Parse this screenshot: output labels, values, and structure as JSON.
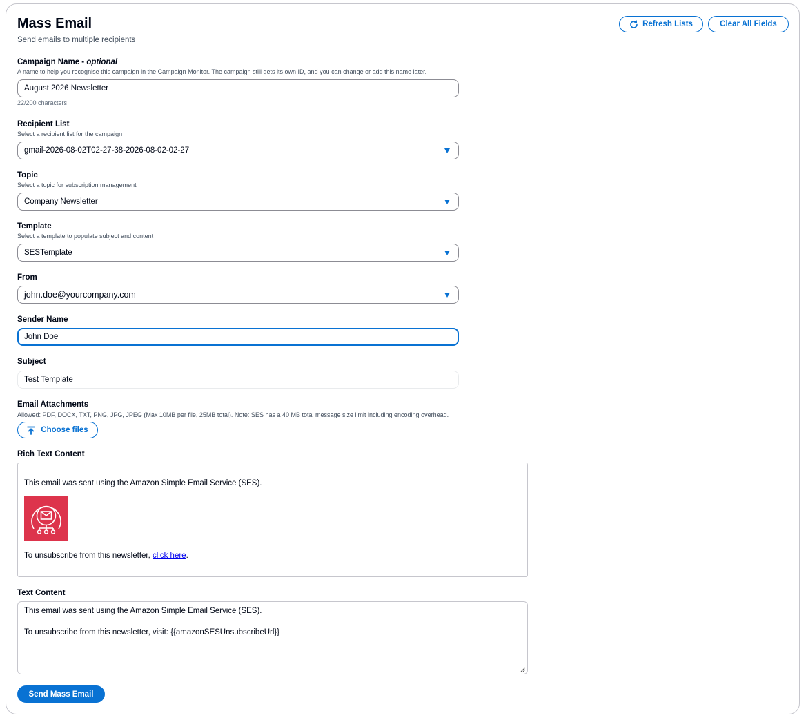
{
  "header": {
    "title": "Mass Email",
    "description": "Send emails to multiple recipients",
    "refresh_label": "Refresh Lists",
    "clear_label": "Clear All Fields"
  },
  "campaign": {
    "label": "Campaign Name",
    "label_suffix": "optional",
    "description": "A name to help you recognise this campaign in the Campaign Monitor. The campaign still gets its own ID, and you can change or add this name later.",
    "value": "August 2026 Newsletter",
    "counter": "22/200 characters"
  },
  "recipient_list": {
    "label": "Recipient List",
    "description": "Select a recipient list for the campaign",
    "value": "gmail-2026-08-02T02-27-38-2026-08-02-02-27"
  },
  "topic": {
    "label": "Topic",
    "description": "Select a topic for subscription management",
    "value": "Company Newsletter"
  },
  "template": {
    "label": "Template",
    "description": "Select a template to populate subject and content",
    "value": "SESTemplate"
  },
  "from": {
    "label": "From",
    "value": "john.doe@yourcompany.com"
  },
  "sender_name": {
    "label": "Sender Name",
    "value": "John Doe"
  },
  "subject": {
    "label": "Subject",
    "value": "Test Template"
  },
  "attachments": {
    "label": "Email Attachments",
    "description": "Allowed: PDF, DOCX, TXT, PNG, JPG, JPEG (Max 10MB per file, 25MB total). Note: SES has a 40 MB total message size limit including encoding overhead.",
    "button_label": "Choose files"
  },
  "rich_text": {
    "label": "Rich Text Content",
    "line1": "This email was sent using the Amazon Simple Email Service (SES).",
    "line2_prefix": "To unsubscribe from this newsletter, ",
    "line2_link": "click here",
    "line2_suffix": "."
  },
  "text_content": {
    "label": "Text Content",
    "line1": "This email was sent using the Amazon Simple Email Service (SES).",
    "line2": "To unsubscribe from this newsletter, visit: {{amazonSESUnsubscribeUrl}}"
  },
  "send_label": "Send Mass Email",
  "colors": {
    "accent": "#0972d3",
    "logo_bg": "#dd344c",
    "text": "#000716",
    "muted": "#414d5c"
  },
  "icons": {
    "refresh": "refresh-icon",
    "upload": "upload-icon",
    "caret": "caret-down-icon",
    "logo": "ses-logo-icon"
  }
}
